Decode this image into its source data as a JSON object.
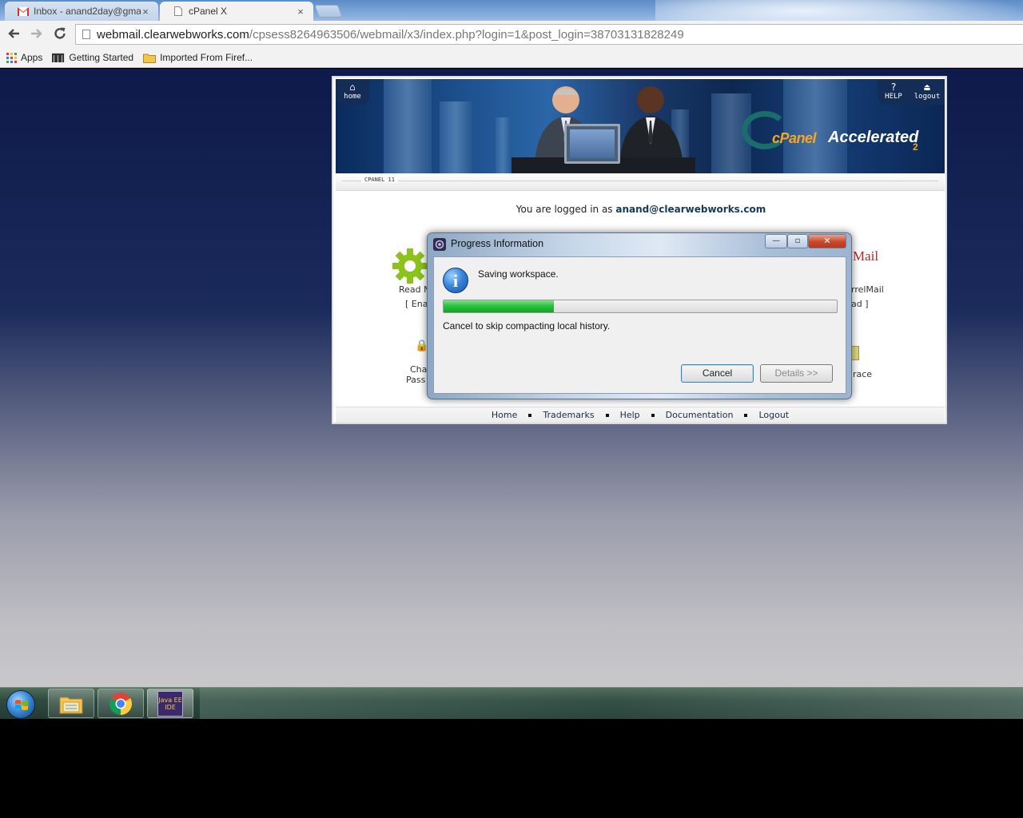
{
  "browser": {
    "tabs": [
      {
        "title": "Inbox - anand2day@gmai",
        "icon": "gmail-icon",
        "active": false
      },
      {
        "title": "cPanel X",
        "icon": "page-icon",
        "active": true
      }
    ],
    "close_glyph": "×",
    "url_host": "webmail.clearwebworks.com",
    "url_path": "/cpsess8264963506/webmail/x3/index.php?login=1&post_login=38703131828249",
    "bookmarks": [
      {
        "label": "Apps",
        "icon": "apps-grid-icon"
      },
      {
        "label": "Getting Started",
        "icon": "m-icon"
      },
      {
        "label": "Imported From Firef...",
        "icon": "folder-icon"
      }
    ]
  },
  "cpanel": {
    "header_tabs": {
      "home": "home",
      "help": "HELP",
      "logout": "logout"
    },
    "logo_text_a": "cPanel",
    "logo_text_b": "Accelerated",
    "logo_sub": "2",
    "section_label": "CPANEL 11",
    "login_prefix": "You are logged in as",
    "login_user": "anand@clearwebworks.com",
    "partial_items": {
      "read_mail": "Read M",
      "enable": "[ Ena",
      "change": "Cha",
      "password": "Pass",
      "squirrelmail_logo": "Mail",
      "squirrelmail": "irrelMail",
      "load": "ad ]",
      "trace": "race"
    },
    "footer_links": [
      "Home",
      "Trademarks",
      "Help",
      "Documentation",
      "Logout"
    ]
  },
  "dialog": {
    "title": "Progress Information",
    "message": "Saving workspace.",
    "progress_fraction": 0.28,
    "subtext": "Cancel to skip compacting local history.",
    "cancel_label": "Cancel",
    "details_label": "Details >>",
    "window_buttons": {
      "minimize": "—",
      "restore": "▫",
      "close": "✕"
    },
    "info_glyph": "i"
  },
  "taskbar": {
    "items": [
      "windows-explorer-icon",
      "chrome-icon",
      "java-ee-ide-icon"
    ],
    "javaee_label": "Java EE IDE"
  },
  "colors": {
    "progress_green": "#2cc23f",
    "login_user": "#173a57"
  }
}
